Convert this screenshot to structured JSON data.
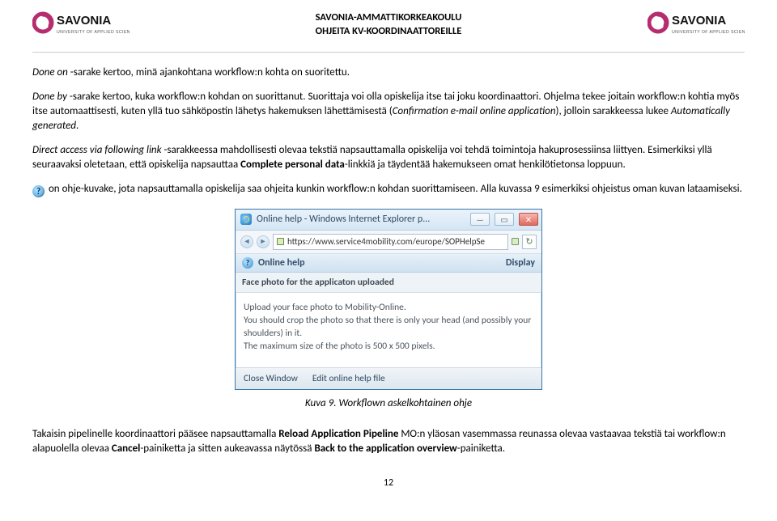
{
  "header": {
    "line1": "SAVONIA-AMMATTIKORKEAKOULU",
    "line2": "OHJEITA KV-KOORDINAATTOREILLE",
    "logo_brand": "SAVONIA",
    "logo_sub": "UNIVERSITY OF APPLIED SCIENCES"
  },
  "paragraphs": {
    "p1_a": "Done on",
    "p1_b": " -sarake kertoo, minä ajankohtana workflow:n kohta on suoritettu.",
    "p2_a": "Done by",
    "p2_b": " -sarake kertoo, kuka workflow:n kohdan on suorittanut. Suorittaja voi olla opiskelija itse tai joku koordinaattori. Ohjelma tekee joitain workflow:n kohtia myös itse automaattisesti, kuten yllä tuo sähköpostin lähetys hakemuksen lähettämisestä (",
    "p2_c": "Confirmation e-mail online application",
    "p2_d": "), jolloin sarakkeessa lukee ",
    "p2_e": "Automatically generated",
    "p2_f": ".",
    "p3_a": "Direct access via following link",
    "p3_b": " -sarakkeessa mahdollisesti olevaa tekstiä napsauttamalla opiskelija voi tehdä toimintoja hakuprosessiinsa liittyen. Esimerkiksi yllä seuraavaksi oletetaan, että opiskelija napsauttaa ",
    "p3_c": "Complete personal data",
    "p3_d": "-linkkiä ja täydentää hakemukseen omat henkilötietonsa loppuun.",
    "p4": " on ohje-kuvake, jota napsauttamalla opiskelija saa ohjeita kunkin workflow:n kohdan suorittamiseen. Alla kuvassa 9 esimerkiksi ohjeistus oman kuvan lataamiseksi.",
    "p5_a": "Takaisin pipelinelle koordinaattori pääsee napsauttamalla ",
    "p5_b": "Reload Application Pipeline",
    "p5_c": " MO:n yläosan vasemmassa reunassa olevaa vastaavaa tekstiä tai workflow:n alapuolella olevaa ",
    "p5_d": "Cancel",
    "p5_e": "-painiketta ja sitten aukeavassa näytössä ",
    "p5_f": "Back to the application overview",
    "p5_g": "-painiketta."
  },
  "ie": {
    "title": "Online help - Windows Internet Explorer p...",
    "url": "https://www.service4mobility.com/europe/SOPHelpSe",
    "header_left": "Online help",
    "header_right": "Display",
    "section_title": "Face photo for the applicaton uploaded",
    "body_l1": "Upload your face photo to Mobility-Online.",
    "body_l2": "You should crop the photo so that there is only your head (and possibly your shoulders) in it.",
    "body_l3": "The maximum size of the photo is 500 x 500 pixels.",
    "foot_close": "Close Window",
    "foot_edit": "Edit online help file"
  },
  "caption": "Kuva 9. Workflown askelkohtainen ohje",
  "page_number": "12"
}
